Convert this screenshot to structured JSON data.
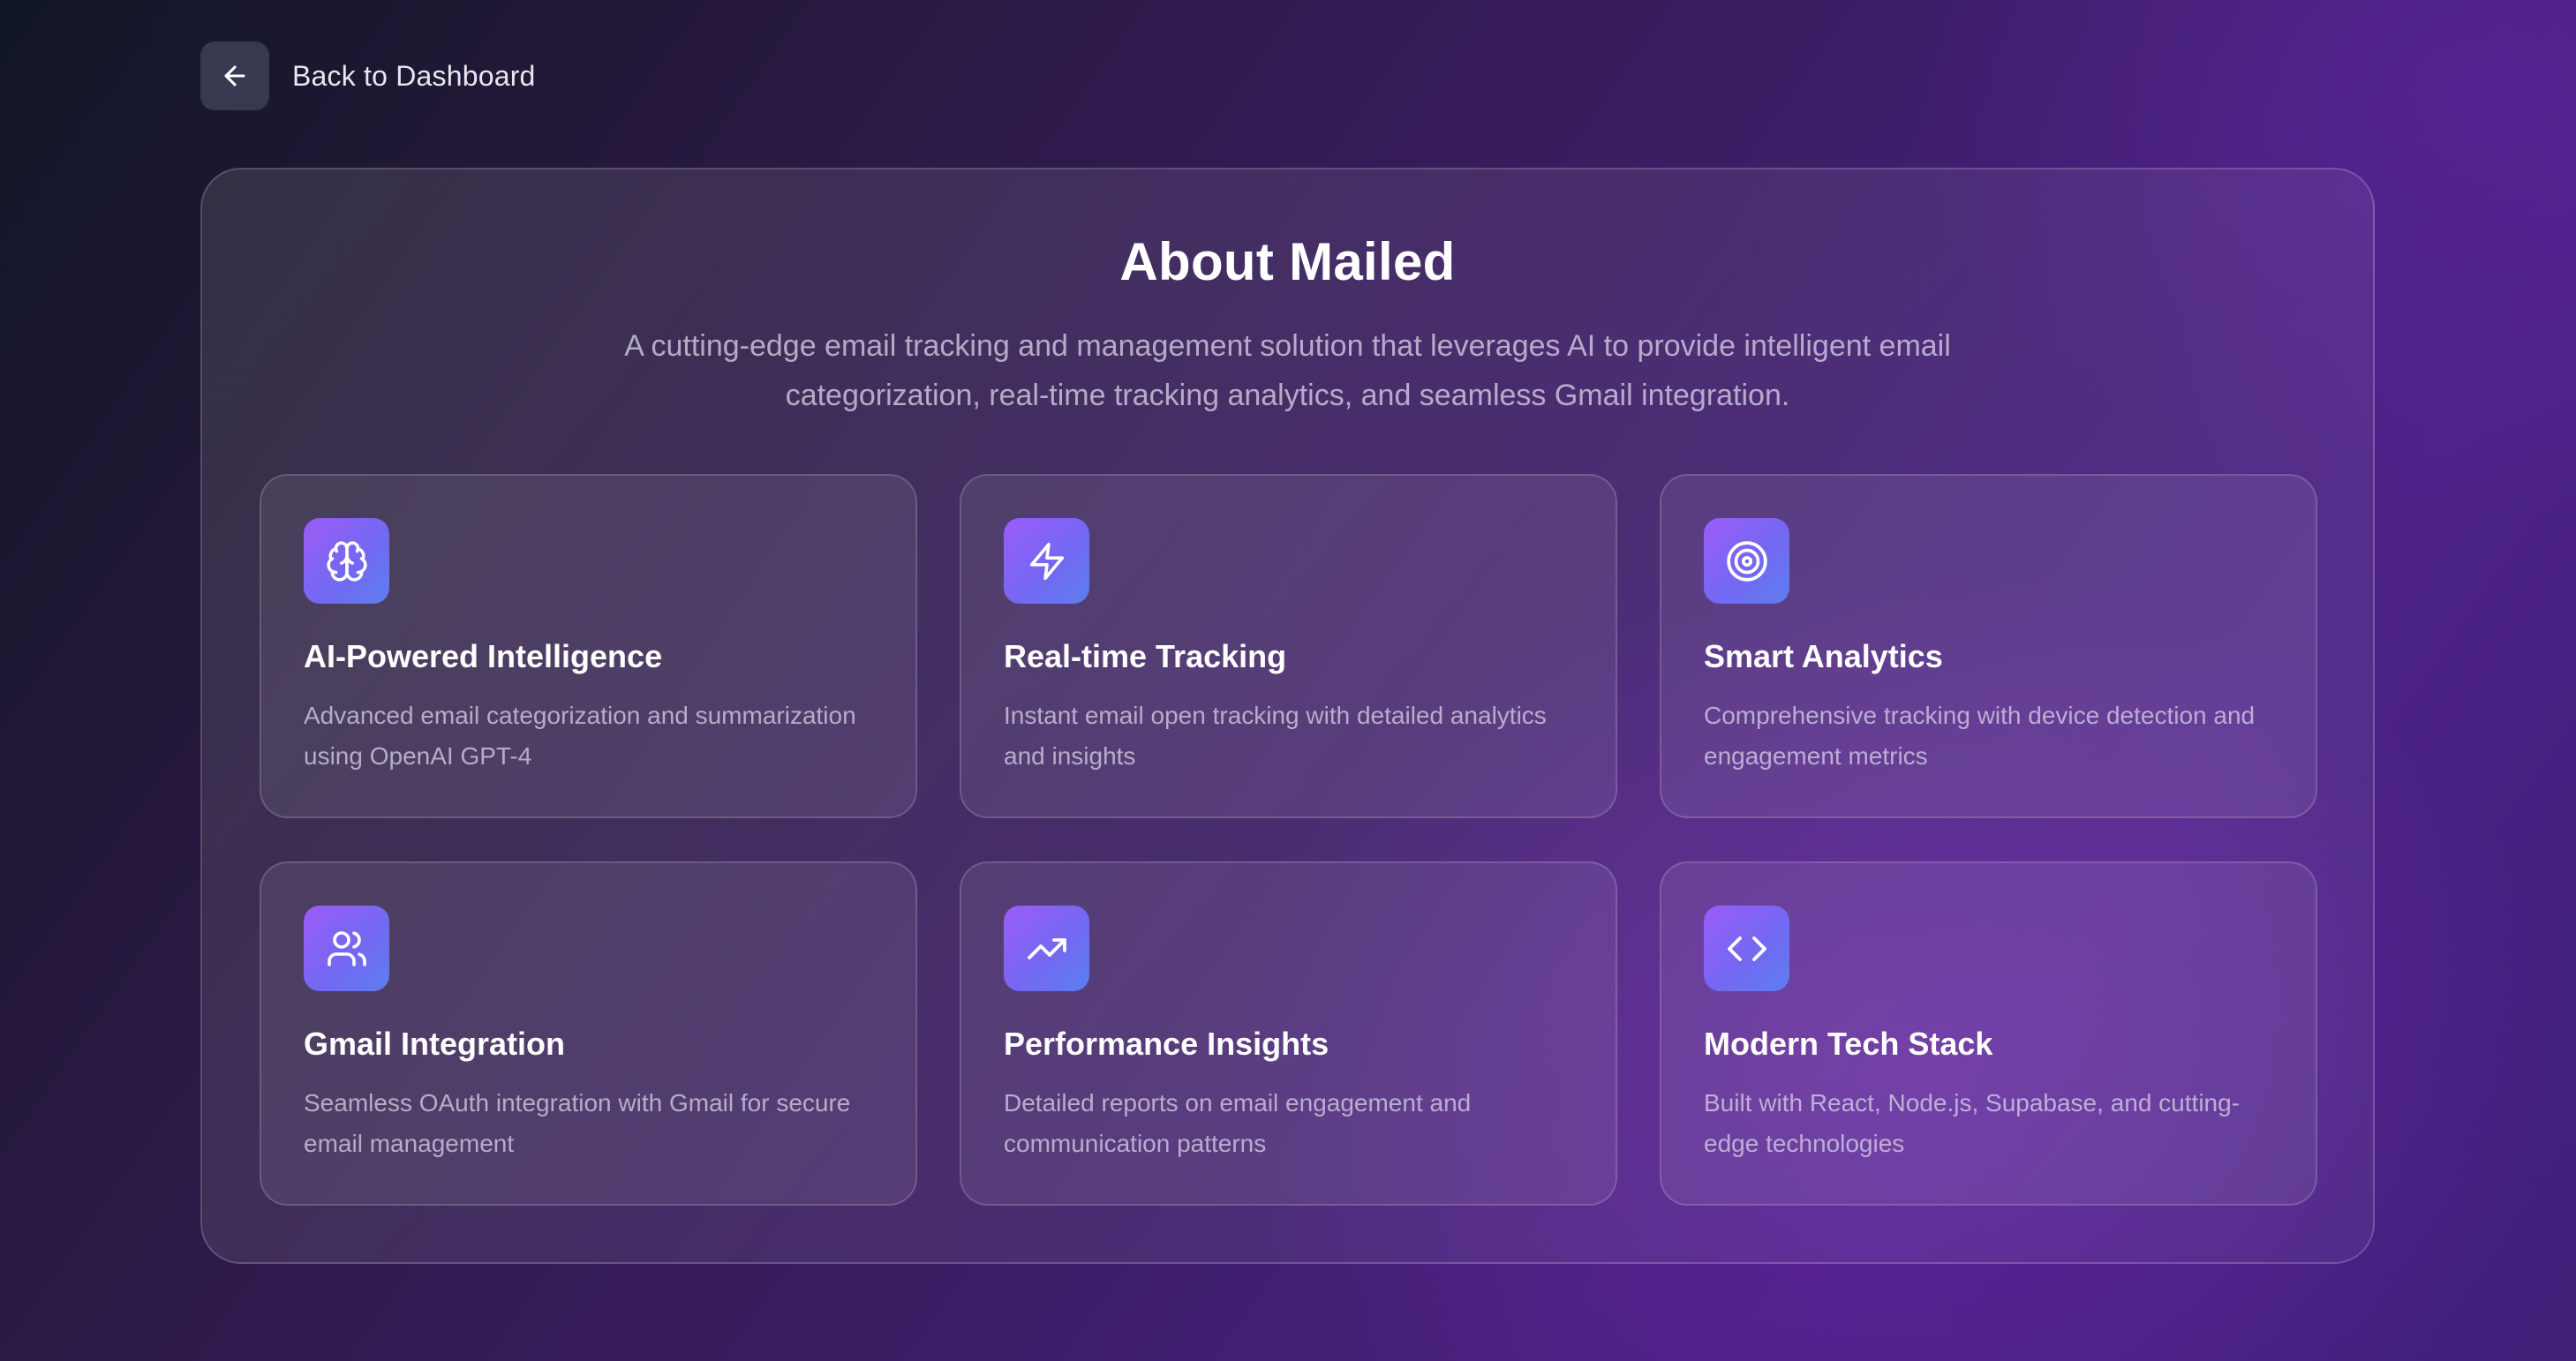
{
  "nav": {
    "back_label": "Back to Dashboard",
    "back_icon": "arrow-left-icon"
  },
  "about": {
    "title": "About Mailed",
    "description": "A cutting-edge email tracking and management solution that leverages AI to provide intelligent email categorization, real-time tracking analytics, and seamless Gmail integration."
  },
  "features": [
    {
      "icon": "brain-icon",
      "title": "AI-Powered Intelligence",
      "description": "Advanced email categorization and summarization using OpenAI GPT-4"
    },
    {
      "icon": "lightning-icon",
      "title": "Real-time Tracking",
      "description": "Instant email open tracking with detailed analytics and insights"
    },
    {
      "icon": "target-icon",
      "title": "Smart Analytics",
      "description": "Comprehensive tracking with device detection and engagement metrics"
    },
    {
      "icon": "users-icon",
      "title": "Gmail Integration",
      "description": "Seamless OAuth integration with Gmail for secure email management"
    },
    {
      "icon": "trending-up-icon",
      "title": "Performance Insights",
      "description": "Detailed reports on email engagement and communication patterns"
    },
    {
      "icon": "code-icon",
      "title": "Modern Tech Stack",
      "description": "Built with React, Node.js, Supabase, and cutting-edge technologies"
    }
  ],
  "colors": {
    "icon_gradient_start": "#9b5cf6",
    "icon_gradient_end": "#5b7ef0",
    "background_dark": "#101626",
    "background_purple": "#4c2186"
  }
}
